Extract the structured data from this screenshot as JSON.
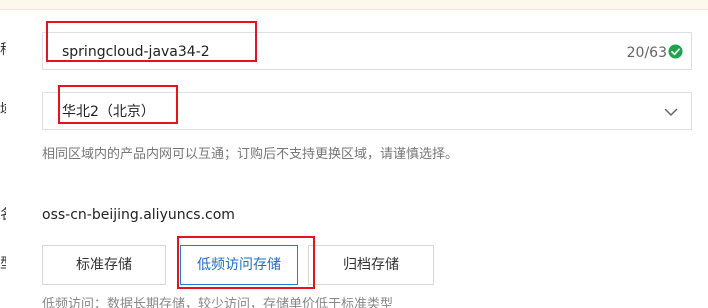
{
  "bucket_name": {
    "value": "springcloud-java34-2",
    "counter": "20/63"
  },
  "region": {
    "selected": "华北2（北京）",
    "hint": "相同区域内的产品内网可以互通；订购后不支持更换区域，请谨慎选择。"
  },
  "endpoint": {
    "value": "oss-cn-beijing.aliyuncs.com"
  },
  "storage_class": {
    "options": [
      "标准存储",
      "低频访问存储",
      "归档存储"
    ],
    "selected_index": 1,
    "description": "低频访问：数据长期存储，较少访问，存储单价低于标准类型"
  },
  "icons": {
    "valid": "check-circle-icon",
    "dropdown": "chevron-down-icon"
  },
  "colors": {
    "accent": "#1f7fd8",
    "valid": "#1ea54c",
    "annotation": "#e3141f"
  }
}
